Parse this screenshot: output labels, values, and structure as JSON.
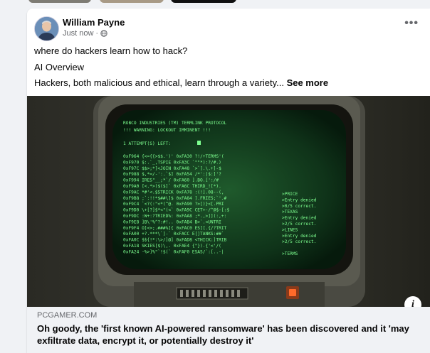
{
  "post": {
    "author": "William Payne",
    "timestamp": "Just now",
    "visibility_icon": "globe-icon",
    "more_icon": "more-options-icon",
    "more_label": "•••",
    "lines": [
      "where do hackers learn how to hack?",
      "AI Overview"
    ],
    "snippet": "Hackers, both malicious and ethical, learn through a variety...",
    "see_more": "See more"
  },
  "media": {
    "info_label": "i",
    "terminal": {
      "header1": "ROBCO INDUSTRIES (TM) TERMLINK PROTOCOL",
      "header2": "!!! WARNING: LOCKOUT IMMINENT !!!",
      "attempts": "1 ATTEMPT(S) LEFT:",
      "left_rows": [
        "0xF964 {<={{>$$.')' 0xFA30 ?!/+TERMS'(",
        "0xF970 $:.`_,TSPIE 0xFA3C `\"\"*):?/#.)",
        "0xF97C $$>;*]<JOIN 0xFA48 `>`].\\.+]-$",
        "0xF988 $,*=/-':.`$] 0xFA54 /*':|$:]'?",
        "0xF994 IRES\"__;*`/ 0xFA60 ].BO.[':/#",
        "0xF9A0 [<.*>)$($]` 0xFA6C THIRD_![*).",
        "0xF9AC *#'<.$STRICK 0xFA78 :(!].08--(,",
        "0xF9B8 ;`:!!*$##\\]$ 0xFA84 ].FRIES;`'.#",
        "0xF9C4 `<?(:\"<*(^@. 0xFA90 ?>[)}<[.PRI",
        "0xF9D0 \\+[?]$*<\"(<` 0xFA9C CET+-/^@$-[:$",
        "0xF9DC :W+:?TRIED%: 0xFAA8 ;*.,>]](:,+:",
        "0xF9E8 ]B\\'%^?:#!.. 0xFAB4 B>`.<UNTRI",
        "0xF9F4 O]<>;.###%]{ 0xFAC0 ES][.{/?TRIT",
        "0xFA00 +?.***\\`]-` 0xFACC E[]TANKS:##`",
        "0xFA0C $${!*:\\>/]@] 0xFAD8 <THICK:]TRIB",
        "0xFA18 SKIES[$)\\,. 0xFAE4 {\"}).{'<'/(",
        "0xFA24 -%>]%\"`!$(` 0xFAF0 ESAS/`:[..-|"
      ],
      "right_rows": [
        ">PRICE",
        ">Entry denied",
        ">0/5 correct.",
        ">TEXAS",
        ">Entry denied",
        ">2/5 correct.",
        ">LINES",
        ">Entry denied",
        ">2/5 correct.",
        "",
        ">TERMS"
      ]
    }
  },
  "link": {
    "domain": "PCGAMER.COM",
    "headline": "Oh goody, the 'first known AI-powered ransomware' has been discovered and it 'may exfiltrate data, encrypt it, or potentially destroy it'"
  }
}
